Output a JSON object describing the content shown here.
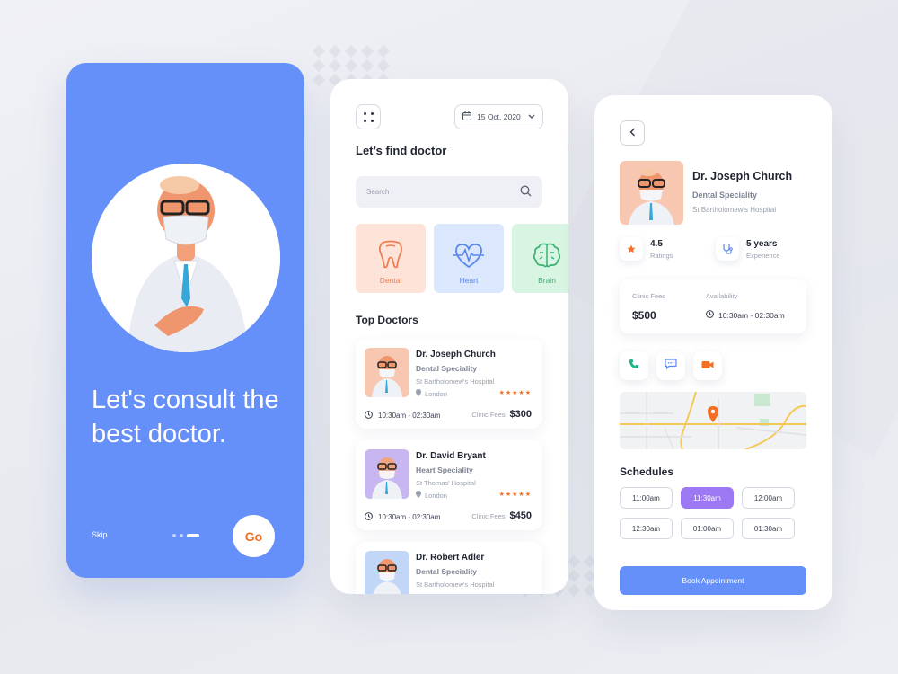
{
  "onboarding": {
    "headline": "Let's consult the best doctor.",
    "skip_label": "Skip",
    "go_label": "Go"
  },
  "home": {
    "date_label": "15 Oct, 2020",
    "title": "Let’s find doctor",
    "search_placeholder": "Search",
    "categories": [
      {
        "label": "Dental",
        "icon": "tooth-icon"
      },
      {
        "label": "Heart",
        "icon": "heart-pulse-icon"
      },
      {
        "label": "Brain",
        "icon": "brain-icon"
      }
    ],
    "top_doctors_title": "Top Doctors",
    "clinic_fees_label": "Clinic Fees",
    "doctors": [
      {
        "name": "Dr. Joseph Church",
        "speciality": "Dental Speciality",
        "hospital": "St Bartholomew's Hospital",
        "location": "London",
        "stars": "★★★★★",
        "time": "10:30am - 02:30am",
        "fee": "$300"
      },
      {
        "name": "Dr. David Bryant",
        "speciality": "Heart Speciality",
        "hospital": "St Thomas' Hospital",
        "location": "London",
        "stars": "★★★★★",
        "time": "10:30am - 02:30am",
        "fee": "$450"
      },
      {
        "name": "Dr. Robert Adler",
        "speciality": "Dental Speciality",
        "hospital": "St Bartholomew's Hospital"
      }
    ]
  },
  "detail": {
    "name": "Dr. Joseph Church",
    "speciality": "Dental Speciality",
    "hospital": "St Bartholomew's Hospital",
    "rating_value": "4.5",
    "rating_label": "Ratings",
    "experience_value": "5 years",
    "experience_label": "Experience",
    "clinic_fees_label": "Clinic Fees",
    "clinic_fees_value": "$500",
    "availability_label": "Availability",
    "availability_value": "10:30am - 02:30am",
    "schedules_title": "Schedules",
    "slots": [
      "11:00am",
      "11:30am",
      "12:00am",
      "12:30am",
      "01:00am",
      "01:30am"
    ],
    "selected_slot": "11:30am",
    "book_label": "Book Appointment"
  },
  "colors": {
    "primary_blue": "#6690f9",
    "accent_orange": "#f26f24",
    "slot_purple": "#9c79f3"
  }
}
